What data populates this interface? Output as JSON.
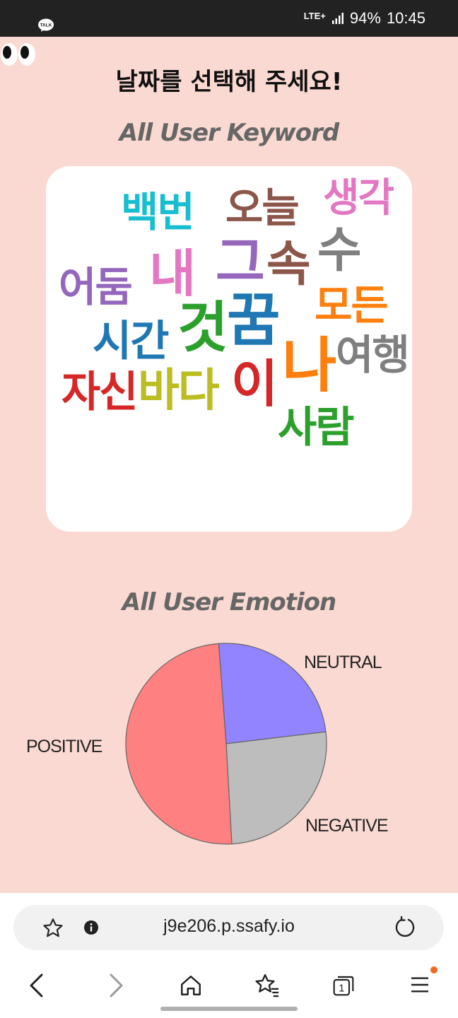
{
  "status_bar": {
    "talk_icon_label": "TALK",
    "network": "LTE+",
    "battery": "94%",
    "time": "10:45"
  },
  "page": {
    "title": "날짜를 선택해 주세요!"
  },
  "keyword_section": {
    "title": "All User Keyword",
    "words": [
      {
        "text": "백번",
        "color": "#17becf"
      },
      {
        "text": "오늘",
        "color": "#8c564b"
      },
      {
        "text": "생각",
        "color": "#e377c2"
      },
      {
        "text": "그",
        "color": "#9467bd"
      },
      {
        "text": "속",
        "color": "#8c564b"
      },
      {
        "text": "수",
        "color": "#7f7f7f"
      },
      {
        "text": "어둠",
        "color": "#9467bd"
      },
      {
        "text": "내",
        "color": "#e377c2"
      },
      {
        "text": "모든",
        "color": "#ff7f0e"
      },
      {
        "text": "시간",
        "color": "#1f77b4"
      },
      {
        "text": "것",
        "color": "#2ca02c"
      },
      {
        "text": "꿈",
        "color": "#1f77b4"
      },
      {
        "text": "나",
        "color": "#ff7f0e"
      },
      {
        "text": "여행",
        "color": "#7f7f7f"
      },
      {
        "text": "자신",
        "color": "#d62728"
      },
      {
        "text": "바다",
        "color": "#bcbd22"
      },
      {
        "text": "이",
        "color": "#d62728"
      },
      {
        "text": "사람",
        "color": "#2ca02c"
      }
    ]
  },
  "emotion_section": {
    "title": "All User Emotion",
    "chart_data": {
      "type": "pie",
      "labels": [
        "NEUTRAL",
        "NEGATIVE",
        "POSITIVE"
      ],
      "values": [
        24.3,
        26.0,
        49.7
      ],
      "colors": [
        "#9283ff",
        "#bdbdbd",
        "#ff8080"
      ],
      "start_angle_deg": -4.3
    }
  },
  "browser": {
    "url": "j9e206.p.ssafy.io",
    "tab_count": "1",
    "accent_dot_color": "#f26a1b"
  }
}
